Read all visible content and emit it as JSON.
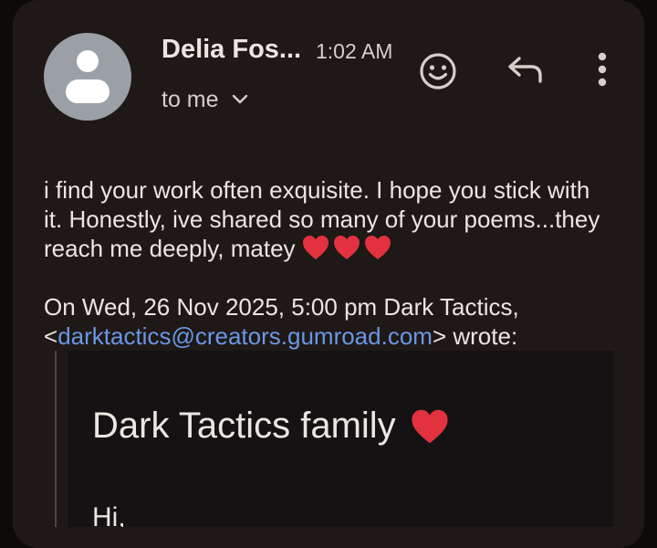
{
  "email": {
    "sender_name": "Delia Fos...",
    "time": "1:02 AM",
    "recipient_label": "to me",
    "body_text": "i find your work often exquisite. I hope you stick with it. Honestly, ive shared so many of your poems...they reach me deeply, matey",
    "quote_header_prefix": "On Wed, 26 Nov 2025, 5:00 pm Dark Tactics,",
    "quote_email_open": "<",
    "quote_email": "darktactics@creators.gumroad.com",
    "quote_email_close": "> wrote:",
    "quoted": {
      "title": "Dark Tactics family",
      "greeting": "Hi,"
    }
  },
  "icons": {
    "avatar": "person-icon",
    "react": "emoji-smile-icon",
    "reply": "reply-icon",
    "more": "more-vert-icon",
    "expand": "chevron-down-icon",
    "heart": "red-heart-emoji"
  },
  "colors": {
    "background": "#0d0a09",
    "card": "#1e1816",
    "link": "#6b97e6",
    "heart": "#e2313f",
    "avatar": "#9aa0a6"
  }
}
